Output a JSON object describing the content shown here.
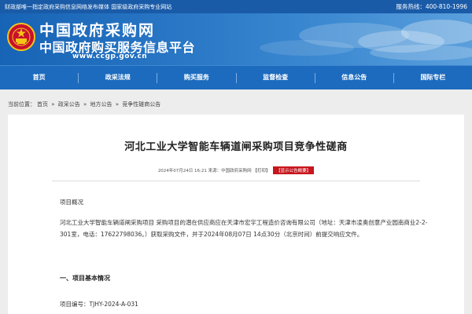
{
  "topbar": {
    "left_text": "财政部唯一指定政府采购信息网络发布媒体  国家级政府采购专业网站",
    "service_label": "服务热线：400-810-1996"
  },
  "banner": {
    "title_cn": "中国政府采购网",
    "subtitle_cn": "中国政府购买服务信息平台",
    "url": "www.ccgp.gov.cn"
  },
  "nav": {
    "items": [
      "首页",
      "政采法规",
      "购买服务",
      "监督检查",
      "信息公告",
      "国际专栏"
    ]
  },
  "breadcrumb": {
    "prefix": "当前位置：",
    "items": [
      "首页",
      "政采公告",
      "地方公告",
      "竞争性磋商公告"
    ],
    "separator": "»"
  },
  "article": {
    "title": "河北工业大学智能车辆道闸采购项目竞争性磋商",
    "meta_text": "2024年07月24日 16:21 来源：中国政府采购网",
    "print_label": "【打印】",
    "show_label": "【显示公告概要】",
    "para1": "项目概况",
    "para2": "河北工业大学智能车辆道闸采购项目 采购项目的潜在供应商应在天津市宏宇工程造价咨询有限公司（地址：天津市凌奥创意产业园南商业2-2-301室，电话：17622798036。）获取采购文件，并于2024年08月07日 14点30分（北京时间）前提交响应文件。",
    "section1": "一、项目基本情况",
    "para3": "项目编号：TJHY-2024-A-031"
  },
  "colors": {
    "topbar": "#1a5ba8",
    "nav": "#1c6bbf",
    "accent_red": "#c7161d",
    "page_bg": "#ededed"
  },
  "icons": {
    "emblem": "national-emblem-icon"
  }
}
